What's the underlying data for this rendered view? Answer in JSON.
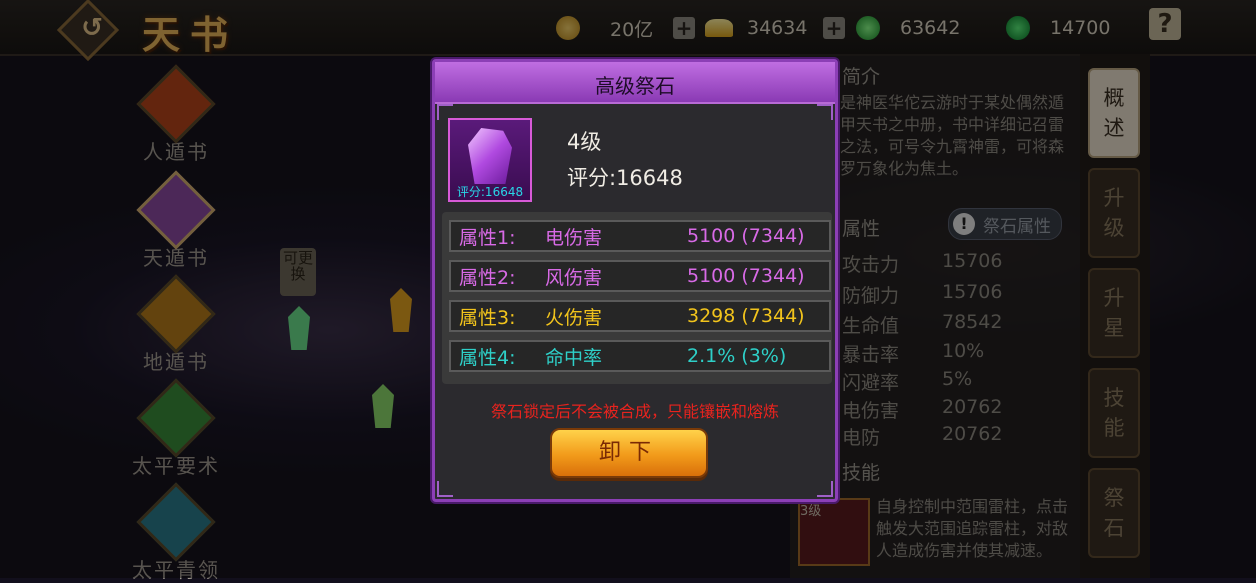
{
  "header": {
    "back_icon": "back-arrow-icon",
    "title": "天书",
    "resources": [
      {
        "icon": "coin-icon",
        "color": "#d9a93a",
        "value": "20亿"
      },
      {
        "icon": "ingot-icon",
        "color": "#e0c04a",
        "value": "34634"
      },
      {
        "icon": "green-crystal-icon",
        "color": "#2ec04a",
        "value": "63642"
      },
      {
        "icon": "jade-icon",
        "color": "#1aa04a",
        "value": "14700"
      }
    ],
    "plus_label": "+",
    "help_label": "?"
  },
  "left_menu": {
    "items": [
      {
        "label": "人遁书",
        "color": "#b4441a"
      },
      {
        "label": "天遁书",
        "color": "#8a4aa0"
      },
      {
        "label": "地遁书",
        "color": "#b47a1a"
      },
      {
        "label": "太平要术",
        "color": "#3a8a3a"
      },
      {
        "label": "太平青领",
        "color": "#2a7a8a"
      }
    ],
    "changeable_tag": "可更换"
  },
  "right_panel": {
    "intro_title": "简介",
    "intro_text": "是神医华佗云游时于某处偶然遁甲天书之中册，书中详细记召雷之法，可号令九霄神雷，可将森罗万象化为焦土。",
    "attr_title": "属性",
    "attr_button": "祭石属性",
    "attr_button_icon": "!",
    "stats": [
      {
        "name": "攻击力",
        "value": "15706"
      },
      {
        "name": "防御力",
        "value": "15706"
      },
      {
        "name": "生命值",
        "value": "78542"
      },
      {
        "name": "暴击率",
        "value": "10%"
      },
      {
        "name": "闪避率",
        "value": "5%"
      },
      {
        "name": "电伤害",
        "value": "20762"
      },
      {
        "name": "电防",
        "value": "20762"
      }
    ],
    "skill_title": "技能",
    "skill_level": "3级",
    "skill_text": "自身控制中范围雷柱，点击触发大范围追踪雷柱，对敌人造成伤害并使其减速。"
  },
  "tabs": [
    {
      "label": "概述",
      "active": true
    },
    {
      "label": "升级",
      "active": false
    },
    {
      "label": "升星",
      "active": false
    },
    {
      "label": "技能",
      "active": false
    },
    {
      "label": "祭石",
      "active": false
    }
  ],
  "dialog": {
    "title": "高级祭石",
    "item": {
      "level": "4级",
      "score": "评分:16648",
      "score_tag": "评分:16648"
    },
    "attributes": [
      {
        "key": "属性1:",
        "name": "电伤害",
        "value": "5100 (7344)",
        "color": "#d86ae6"
      },
      {
        "key": "属性2:",
        "name": "风伤害",
        "value": "5100 (7344)",
        "color": "#d86ae6"
      },
      {
        "key": "属性3:",
        "name": "火伤害",
        "value": "3298 (7344)",
        "color": "#f2c41c"
      },
      {
        "key": "属性4:",
        "name": "命中率",
        "value": "2.1% (3%)",
        "color": "#2ed0c8"
      }
    ],
    "warning": "祭石锁定后不会被合成，只能镶嵌和熔炼",
    "unequip_label": "卸下"
  }
}
